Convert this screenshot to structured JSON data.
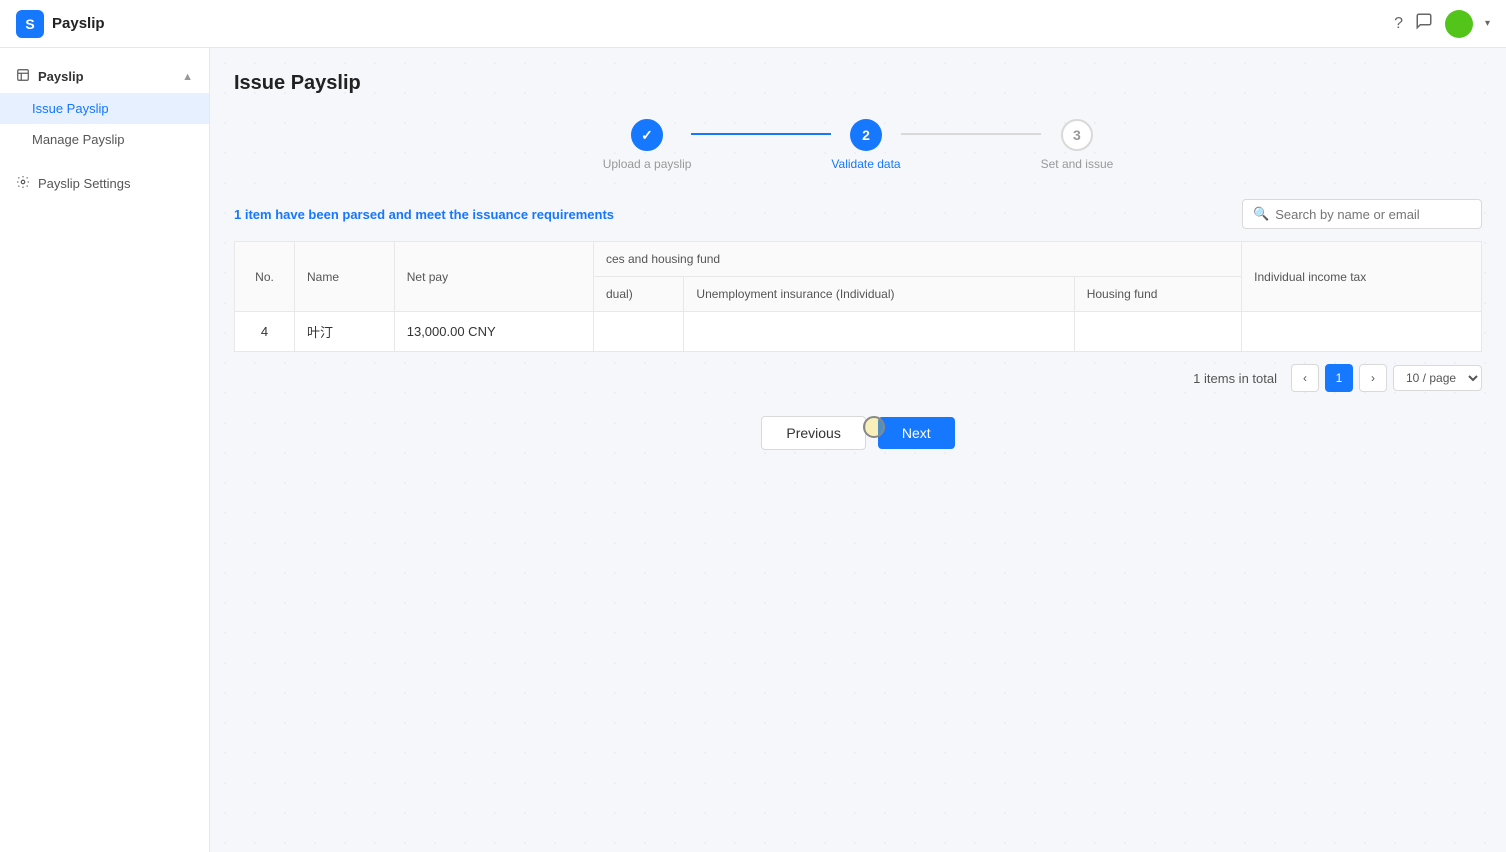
{
  "app": {
    "logo_letter": "S",
    "title": "Payslip"
  },
  "topbar": {
    "help_icon": "?",
    "chat_icon": "💬",
    "avatar_initials": "",
    "arrow": "▾"
  },
  "sidebar": {
    "group_label": "Payslip",
    "items": [
      {
        "id": "issue-payslip",
        "label": "Issue Payslip",
        "active": true
      },
      {
        "id": "manage-payslip",
        "label": "Manage Payslip",
        "active": false
      }
    ],
    "settings_label": "Payslip Settings"
  },
  "page": {
    "title": "Issue Payslip"
  },
  "stepper": {
    "steps": [
      {
        "id": "upload",
        "number": "✓",
        "label": "Upload a payslip",
        "state": "done"
      },
      {
        "id": "validate",
        "number": "2",
        "label": "Validate data",
        "state": "active"
      },
      {
        "id": "issue",
        "number": "3",
        "label": "Set and issue",
        "state": "inactive"
      }
    ]
  },
  "table_header": {
    "parsed_prefix": "1",
    "parsed_text": " item have been parsed and meet the issuance requirements",
    "search_placeholder": "Search by name or email"
  },
  "table": {
    "columns": {
      "no": "No.",
      "name": "Name",
      "net_pay": "Net pay",
      "group_label": "ces and housing fund",
      "medical_label": "dual)",
      "unemployment_label": "Unemployment insurance (Individual)",
      "housing_label": "Housing fund",
      "income_tax_label": "Individual income tax"
    },
    "rows": [
      {
        "no": "4",
        "name": "叶汀",
        "net_pay": "13,000.00 CNY",
        "medical": "",
        "unemployment": "",
        "housing": "",
        "income_tax": ""
      }
    ]
  },
  "pagination": {
    "total_text": "1 items in total",
    "current_page": "1",
    "page_size": "10 / page"
  },
  "buttons": {
    "previous": "Previous",
    "next": "Next"
  }
}
